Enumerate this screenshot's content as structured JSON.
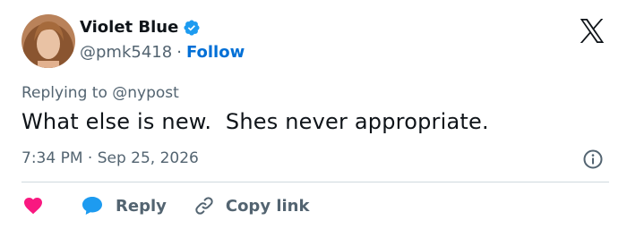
{
  "author": {
    "display_name": "Violet Blue",
    "handle": "@pmk5418",
    "separator": "·",
    "follow_label": "Follow",
    "verified": true
  },
  "icons": {
    "avatar": "profile-photo",
    "verified": "verified-badge-icon",
    "logo": "x-logo-icon",
    "info": "info-icon",
    "like": "heart-icon",
    "reply": "speech-bubble-icon",
    "copy": "link-icon"
  },
  "tweet": {
    "replying_to": "Replying to @nypost",
    "text": "What else is new.  Shes never appropriate.",
    "timestamp": "7:34 PM · Sep 25, 2026"
  },
  "actions": {
    "reply_label": "Reply",
    "copy_link_label": "Copy link"
  },
  "colors": {
    "link": "#006fd6",
    "like": "#f91880",
    "reply_icon": "#1d9bf0",
    "secondary_text": "#536471",
    "verified": "#1d9bf0"
  }
}
